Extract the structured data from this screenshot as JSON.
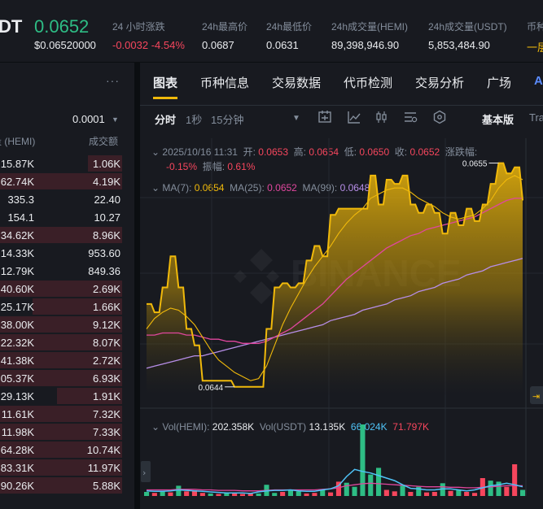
{
  "header": {
    "symbol": "DT",
    "price": "0.0652",
    "price_usd": "$0.06520000",
    "stats": [
      {
        "label": "24 小时涨跌",
        "value": "-0.0032 -4.54%"
      },
      {
        "label": "24h最高价",
        "value": "0.0687"
      },
      {
        "label": "24h最低价",
        "value": "0.0631"
      },
      {
        "label": "24h成交量(HEMI)",
        "value": "89,398,946.90"
      },
      {
        "label": "24h成交量(USDT)",
        "value": "5,853,484.90"
      },
      {
        "label": "币种",
        "value": "一层"
      }
    ]
  },
  "trades": {
    "menu_icon": "more-dots-icon",
    "tick_size": "0.0001",
    "col_amount": "量 (HEMI)",
    "col_value": "成交额",
    "rows": [
      {
        "amount": "15.87K",
        "value": "1.06K",
        "fill": 0.28
      },
      {
        "amount": "62.74K",
        "value": "4.19K",
        "fill": 1.0
      },
      {
        "amount": "335.3",
        "value": "22.40",
        "fill": 0.0
      },
      {
        "amount": "154.1",
        "value": "10.27",
        "fill": 0.0
      },
      {
        "amount": "34.62K",
        "value": "8.96K",
        "fill": 1.0
      },
      {
        "amount": "14.33K",
        "value": "953.60",
        "fill": 0.0
      },
      {
        "amount": "12.79K",
        "value": "849.36",
        "fill": 0.0
      },
      {
        "amount": "40.60K",
        "value": "2.69K",
        "fill": 1.0
      },
      {
        "amount": "25.17K",
        "value": "1.66K",
        "fill": 0.73
      },
      {
        "amount": "38.00K",
        "value": "9.12K",
        "fill": 1.0
      },
      {
        "amount": "22.32K",
        "value": "8.07K",
        "fill": 1.0
      },
      {
        "amount": "41.38K",
        "value": "2.72K",
        "fill": 1.0
      },
      {
        "amount": "05.37K",
        "value": "6.93K",
        "fill": 1.0
      },
      {
        "amount": "29.13K",
        "value": "1.91K",
        "fill": 0.53
      },
      {
        "amount": "11.61K",
        "value": "7.32K",
        "fill": 1.0
      },
      {
        "amount": "11.98K",
        "value": "7.33K",
        "fill": 1.0
      },
      {
        "amount": "64.28K",
        "value": "10.74K",
        "fill": 1.0
      },
      {
        "amount": "83.31K",
        "value": "11.97K",
        "fill": 1.0
      },
      {
        "amount": "90.26K",
        "value": "5.88K",
        "fill": 1.0
      }
    ]
  },
  "tabs": [
    "图表",
    "币种信息",
    "交易数据",
    "代币检测",
    "交易分析",
    "广场",
    "AI"
  ],
  "toolbar": {
    "intervals": [
      "分时",
      "1秒",
      "15分钟"
    ],
    "dropdown_icon": "caret-down-icon",
    "icons": [
      "indicator-settings-icon",
      "line-chart-icon",
      "candlestick-icon",
      "drawing-tools-icon",
      "settings-icon"
    ],
    "version": "基本版",
    "tradingview": "Tra"
  },
  "ohlc": {
    "date": "2025/10/16 11:31",
    "open_label": "开:",
    "open": "0.0653",
    "high_label": "高:",
    "high": "0.0654",
    "low_label": "低:",
    "low": "0.0650",
    "close_label": "收:",
    "close": "0.0652",
    "change_label": "涨跌幅:",
    "change": "-0.15%",
    "amp_label": "振幅:",
    "amp": "0.61%"
  },
  "ma": {
    "ma7_label": "MA(7):",
    "ma7": "0.0654",
    "ma25_label": "MA(25):",
    "ma25": "0.0652",
    "ma99_label": "MA(99):",
    "ma99": "0.0648"
  },
  "vol": {
    "hemi_label": "Vol(HEMI):",
    "hemi": "202.358K",
    "usdt_label": "Vol(USDT)",
    "usdt": "13.185K",
    "ma1": "66.024K",
    "ma2": "71.797K"
  },
  "colors": {
    "up": "#2ebd85",
    "down": "#f6465d",
    "line": "#f0b90b",
    "ma7": "#f0b90b",
    "ma25": "#e0479e",
    "ma99": "#b78ee8",
    "vol_ma1": "#4fc3f7",
    "vol_ma2": "#e0479e"
  },
  "chart_data": {
    "type": "area",
    "max_label": "0.0655",
    "min_label": "0.0644",
    "price": [
      0.06482,
      0.06478,
      0.0649,
      0.06505,
      0.0649,
      0.0647,
      0.06462,
      0.06445,
      0.06445,
      0.06445,
      0.06445,
      0.06442,
      0.06442,
      0.06442,
      0.06442,
      0.0647,
      0.0649,
      0.06492,
      0.0649,
      0.06492,
      0.06503,
      0.0651,
      0.06505,
      0.06525,
      0.06528,
      0.06528,
      0.06528,
      0.06528,
      0.06544,
      0.0653,
      0.06542,
      0.0654,
      0.06544,
      0.0653,
      0.06526,
      0.0653,
      0.06526,
      0.06516,
      0.06526,
      0.0652,
      0.06528,
      0.06522,
      0.0653,
      0.0654,
      0.0655,
      0.06545,
      0.06548,
      0.06532
    ],
    "ma7": [
      0.0647,
      0.06475,
      0.06478,
      0.0648,
      0.06479,
      0.06476,
      0.06472,
      0.06466,
      0.0646,
      0.06455,
      0.06452,
      0.06449,
      0.06447,
      0.06445,
      0.06446,
      0.06452,
      0.06462,
      0.06472,
      0.0648,
      0.06487,
      0.06494,
      0.065,
      0.06505,
      0.0651,
      0.06516,
      0.06521,
      0.06525,
      0.06528,
      0.06533,
      0.06535,
      0.06537,
      0.06538,
      0.06538,
      0.06536,
      0.06533,
      0.06531,
      0.06529,
      0.06526,
      0.06524,
      0.06523,
      0.06524,
      0.06525,
      0.06528,
      0.06532,
      0.06538,
      0.06542,
      0.06544,
      0.06542
    ],
    "ma25": [
      0.06467,
      0.06467,
      0.06468,
      0.06468,
      0.06468,
      0.06467,
      0.06467,
      0.06466,
      0.06465,
      0.06465,
      0.06464,
      0.06464,
      0.06463,
      0.06463,
      0.06463,
      0.06464,
      0.06466,
      0.06468,
      0.0647,
      0.06473,
      0.06476,
      0.06479,
      0.06482,
      0.06486,
      0.0649,
      0.06494,
      0.06497,
      0.065,
      0.06503,
      0.06506,
      0.06509,
      0.06511,
      0.06513,
      0.06515,
      0.06516,
      0.06518,
      0.06519,
      0.0652,
      0.06521,
      0.06522,
      0.06523,
      0.06524,
      0.06526,
      0.06528,
      0.0653,
      0.06532,
      0.06533,
      0.06533
    ],
    "ma99": [
      0.06451,
      0.06452,
      0.06453,
      0.06454,
      0.06455,
      0.06456,
      0.06457,
      0.06457,
      0.06458,
      0.06459,
      0.0646,
      0.06461,
      0.06462,
      0.06463,
      0.06464,
      0.06465,
      0.06466,
      0.06467,
      0.06468,
      0.06469,
      0.0647,
      0.06471,
      0.06472,
      0.06474,
      0.06475,
      0.06476,
      0.06477,
      0.06479,
      0.0648,
      0.06481,
      0.06482,
      0.06484,
      0.06485,
      0.06486,
      0.06488,
      0.06489,
      0.0649,
      0.06492,
      0.06493,
      0.06494,
      0.06496,
      0.06497,
      0.06498,
      0.065,
      0.06501,
      0.06502,
      0.06503,
      0.06504
    ],
    "volume": [
      8,
      6,
      10,
      7,
      20,
      9,
      11,
      6,
      5,
      4,
      7,
      6,
      4,
      5,
      5,
      22,
      6,
      8,
      12,
      9,
      5,
      6,
      12,
      7,
      28,
      26,
      18,
      140,
      42,
      55,
      12,
      9,
      20,
      8,
      18,
      7,
      8,
      25,
      10,
      12,
      8,
      6,
      35,
      30,
      28,
      18,
      62,
      12
    ],
    "volume_up": [
      true,
      false,
      true,
      false,
      true,
      false,
      false,
      false,
      true,
      false,
      true,
      false,
      false,
      false,
      true,
      true,
      true,
      false,
      true,
      true,
      false,
      false,
      true,
      false,
      false,
      true,
      true,
      true,
      true,
      true,
      false,
      false,
      true,
      false,
      true,
      false,
      false,
      true,
      false,
      true,
      false,
      false,
      false,
      true,
      true,
      false,
      false,
      true
    ],
    "vol_ma1": [
      10,
      9,
      9,
      10,
      12,
      11,
      10,
      9,
      8,
      7,
      6,
      6,
      6,
      5,
      8,
      10,
      11,
      11,
      12,
      10,
      9,
      9,
      12,
      14,
      20,
      38,
      52,
      48,
      45,
      40,
      35,
      30,
      22,
      15,
      14,
      12,
      12,
      14,
      14,
      12,
      10,
      12,
      16,
      20,
      22,
      25,
      22,
      18
    ],
    "vol_ma2": [
      12,
      12,
      12,
      12,
      13,
      13,
      13,
      12,
      12,
      11,
      11,
      11,
      10,
      10,
      10,
      11,
      12,
      12,
      12,
      12,
      12,
      12,
      13,
      14,
      16,
      20,
      22,
      24,
      25,
      24,
      23,
      22,
      21,
      20,
      19,
      18,
      18,
      18,
      17,
      17,
      16,
      16,
      17,
      18,
      19,
      20,
      20,
      20
    ],
    "ylim": [
      0.06438,
      0.06562
    ],
    "vol_max": 140
  }
}
